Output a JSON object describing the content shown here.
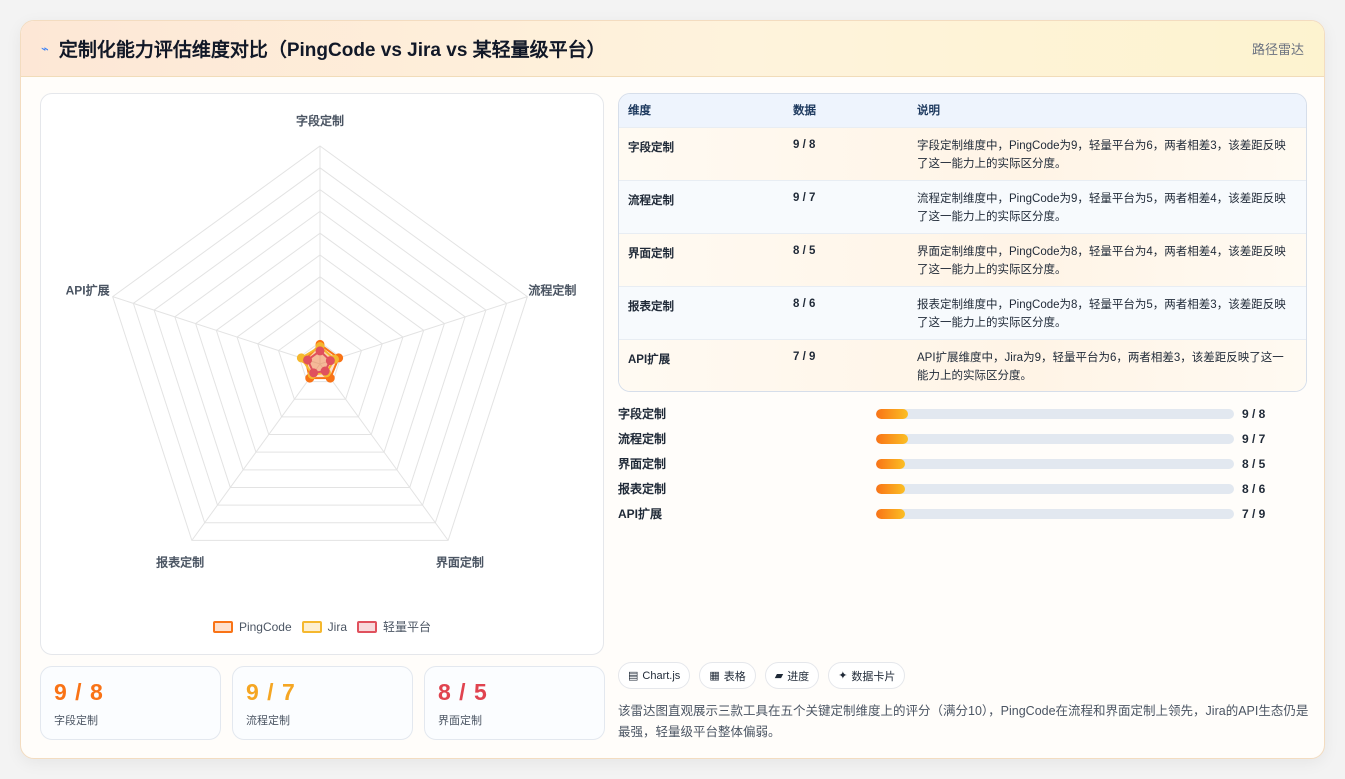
{
  "header": {
    "icon": "line-chart-icon",
    "title": "定制化能力评估维度对比（PingCode vs Jira vs 某轻量级平台）",
    "tag": "路径雷达"
  },
  "colors": {
    "pingcode": "#f97316",
    "jira": "#f5b82e",
    "light": "#e0515d",
    "accent": "#f59e0b"
  },
  "chart_data": {
    "type": "radar",
    "axes": [
      "字段定制",
      "流程定制",
      "界面定制",
      "报表定制",
      "API扩展"
    ],
    "r_range": [
      0,
      100
    ],
    "grid_levels": 10,
    "legend_position": "bottom",
    "series": [
      {
        "name": "PingCode",
        "values": [
          9,
          9,
          8,
          8,
          7
        ]
      },
      {
        "name": "Jira",
        "values": [
          8,
          7,
          5,
          6,
          9
        ]
      },
      {
        "name": "轻量平台",
        "values": [
          6,
          5,
          4,
          5,
          6
        ]
      }
    ]
  },
  "stats": [
    {
      "value": "9 / 8",
      "label": "字段定制"
    },
    {
      "value": "9 / 7",
      "label": "流程定制"
    },
    {
      "value": "8 / 5",
      "label": "界面定制"
    }
  ],
  "table": {
    "headers": [
      "维度",
      "数据",
      "说明"
    ],
    "rows": [
      {
        "dim": "字段定制",
        "data": "9 / 8",
        "desc": "字段定制维度中，PingCode为9，轻量平台为6，两者相差3，该差距反映了这一能力上的实际区分度。"
      },
      {
        "dim": "流程定制",
        "data": "9 / 7",
        "desc": "流程定制维度中，PingCode为9，轻量平台为5，两者相差4，该差距反映了这一能力上的实际区分度。"
      },
      {
        "dim": "界面定制",
        "data": "8 / 5",
        "desc": "界面定制维度中，PingCode为8，轻量平台为4，两者相差4，该差距反映了这一能力上的实际区分度。"
      },
      {
        "dim": "报表定制",
        "data": "8 / 6",
        "desc": "报表定制维度中，PingCode为8，轻量平台为5，两者相差3，该差距反映了这一能力上的实际区分度。"
      },
      {
        "dim": "API扩展",
        "data": "7 / 9",
        "desc": "API扩展维度中，Jira为9，轻量平台为6，两者相差3，该差距反映了这一能力上的实际区分度。"
      }
    ]
  },
  "progress": [
    {
      "label": "字段定制",
      "value": "9 / 8",
      "fraction": 0.09
    },
    {
      "label": "流程定制",
      "value": "9 / 7",
      "fraction": 0.09
    },
    {
      "label": "界面定制",
      "value": "8 / 5",
      "fraction": 0.08
    },
    {
      "label": "报表定制",
      "value": "8 / 6",
      "fraction": 0.08
    },
    {
      "label": "API扩展",
      "value": "7 / 9",
      "fraction": 0.08
    }
  ],
  "chips": [
    {
      "icon": "chart-icon",
      "glyph": "▤",
      "label": "Chart.js"
    },
    {
      "icon": "table-icon",
      "glyph": "▦",
      "label": "表格"
    },
    {
      "icon": "progress-icon",
      "glyph": "▰",
      "label": "进度"
    },
    {
      "icon": "card-icon",
      "glyph": "✦",
      "label": "数据卡片"
    }
  ],
  "summary": "该雷达图直观展示三款工具在五个关键定制维度上的评分（满分10），PingCode在流程和界面定制上领先，Jira的API生态仍是最强，轻量级平台整体偏弱。"
}
